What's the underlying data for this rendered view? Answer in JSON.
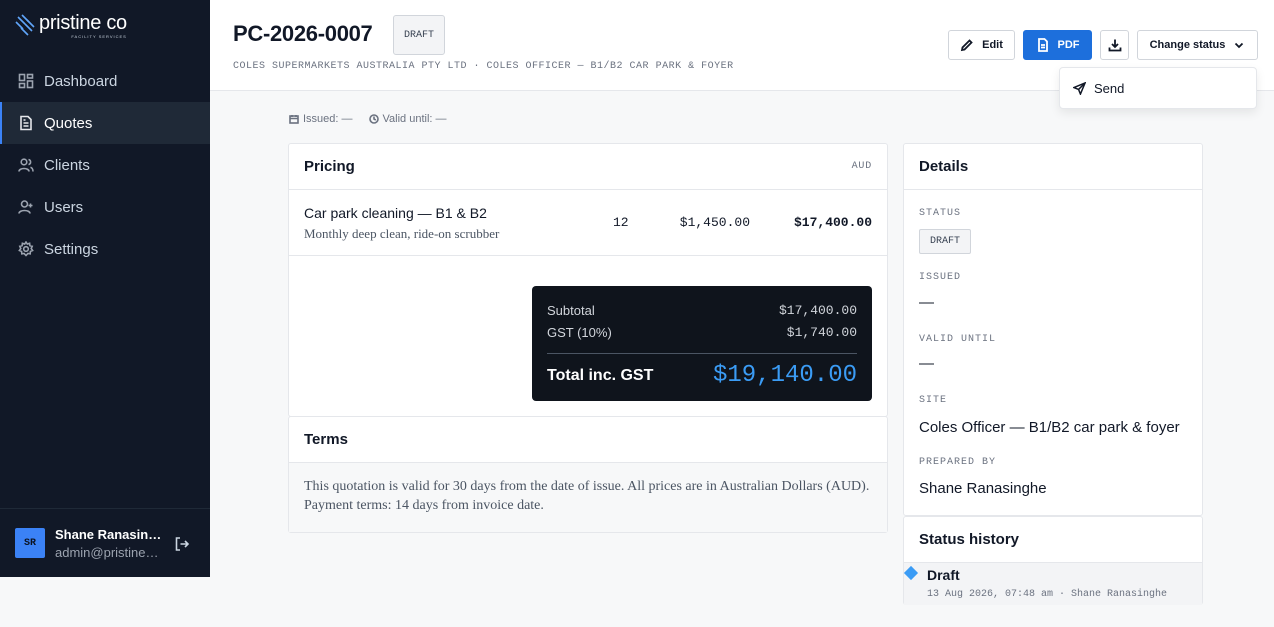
{
  "brand": {
    "name": "pristine co",
    "tagline": "FACILITY SERVICES"
  },
  "nav": [
    {
      "label": "Dashboard",
      "icon": "dashboard-icon"
    },
    {
      "label": "Quotes",
      "icon": "document-icon",
      "active": true
    },
    {
      "label": "Clients",
      "icon": "users-icon"
    },
    {
      "label": "Users",
      "icon": "user-icon"
    },
    {
      "label": "Settings",
      "icon": "gear-icon"
    }
  ],
  "user": {
    "initials": "SR",
    "name": "Shane Ranasinghe",
    "email": "admin@pristineco.com.au"
  },
  "header": {
    "title": "PC-2026-0007",
    "status_pill": "DRAFT",
    "subtitle": "COLES SUPERMARKETS AUSTRALIA PTY LTD · COLES OFFICER — B1/B2 CAR PARK & FOYER",
    "edit_label": "Edit",
    "pdf_label": "PDF",
    "change_status_label": "Change status"
  },
  "dropdown": {
    "send_label": "Send"
  },
  "meta": {
    "issued": "Issued: —",
    "valid_until": "Valid until: —"
  },
  "pricing": {
    "title": "Pricing",
    "currency": "AUD",
    "lines": [
      {
        "name": "Car park cleaning — B1 & B2",
        "description": "Monthly deep clean, ride-on scrubber",
        "qty": "12",
        "rate": "$1,450.00",
        "total": "$17,400.00"
      }
    ],
    "subtotal_label": "Subtotal",
    "subtotal": "$17,400.00",
    "gst_label": "GST (10%)",
    "gst": "$1,740.00",
    "total_label": "Total inc. GST",
    "total": "$19,140.00"
  },
  "terms": {
    "title": "Terms",
    "body": "This quotation is valid for 30 days from the date of issue. All prices are in Australian Dollars (AUD). Payment terms: 14 days from invoice date."
  },
  "details": {
    "title": "Details",
    "status_label": "STATUS",
    "status": "DRAFT",
    "issued_label": "ISSUED",
    "issued": "—",
    "valid_until_label": "VALID UNTIL",
    "valid_until": "—",
    "site_label": "SITE",
    "site": "Coles Officer — B1/B2 car park & foyer",
    "prepared_by_label": "PREPARED BY",
    "prepared_by": "Shane Ranasinghe"
  },
  "history": {
    "title": "Status history",
    "items": [
      {
        "status": "Draft",
        "meta": "13 Aug 2026, 07:48 am · Shane Ranasinghe"
      }
    ]
  },
  "colors": {
    "sidebar_bg": "#111827",
    "accent": "#1d6fdc",
    "total_accent": "#3b9cf5"
  }
}
